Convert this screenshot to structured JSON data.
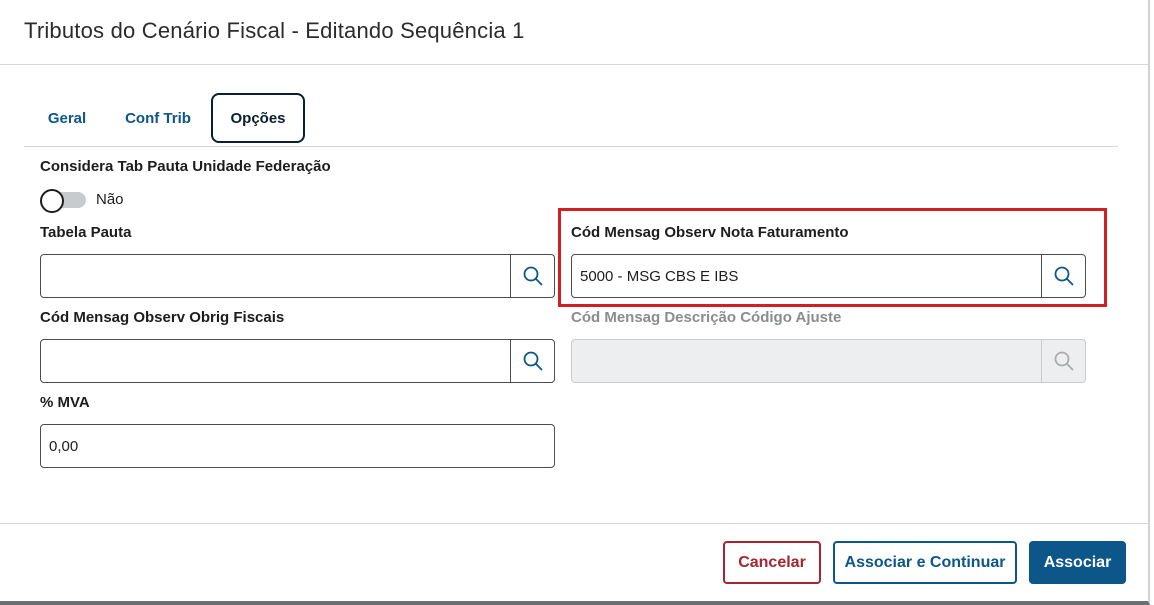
{
  "dialog": {
    "title": "Tributos do Cenário Fiscal - Editando Sequência 1"
  },
  "tabs": [
    {
      "label": "Geral",
      "active": false
    },
    {
      "label": "Conf Trib",
      "active": false
    },
    {
      "label": "Opções",
      "active": true
    }
  ],
  "form": {
    "tab_pauta_uf": {
      "label": "Considera Tab Pauta Unidade Federação",
      "toggle_state": "off",
      "toggle_text": "Não"
    },
    "tabela_pauta": {
      "label": "Tabela Pauta",
      "value": "",
      "search_icon": "search-icon"
    },
    "cod_msg_nota_fat": {
      "label": "Cód Mensag Observ Nota Faturamento",
      "value": "5000 - MSG CBS E IBS",
      "search_icon": "search-icon",
      "highlighted": true,
      "highlight_color": "#d21f26"
    },
    "cod_msg_obrig_fiscais": {
      "label": "Cód Mensag Observ Obrig Fiscais",
      "value": "",
      "search_icon": "search-icon"
    },
    "cod_msg_desc_ajuste": {
      "label": "Cód Mensag Descrição Código Ajuste",
      "value": "",
      "disabled": true,
      "search_icon": "search-icon"
    },
    "mva": {
      "label": "% MVA",
      "value": "0,00"
    }
  },
  "footer": {
    "cancel_label": "Cancelar",
    "assoc_continue_label": "Associar e Continuar",
    "assoc_label": "Associar"
  },
  "colors": {
    "primary": "#0c5689",
    "danger": "#a5262e",
    "highlight": "#d21f26"
  }
}
